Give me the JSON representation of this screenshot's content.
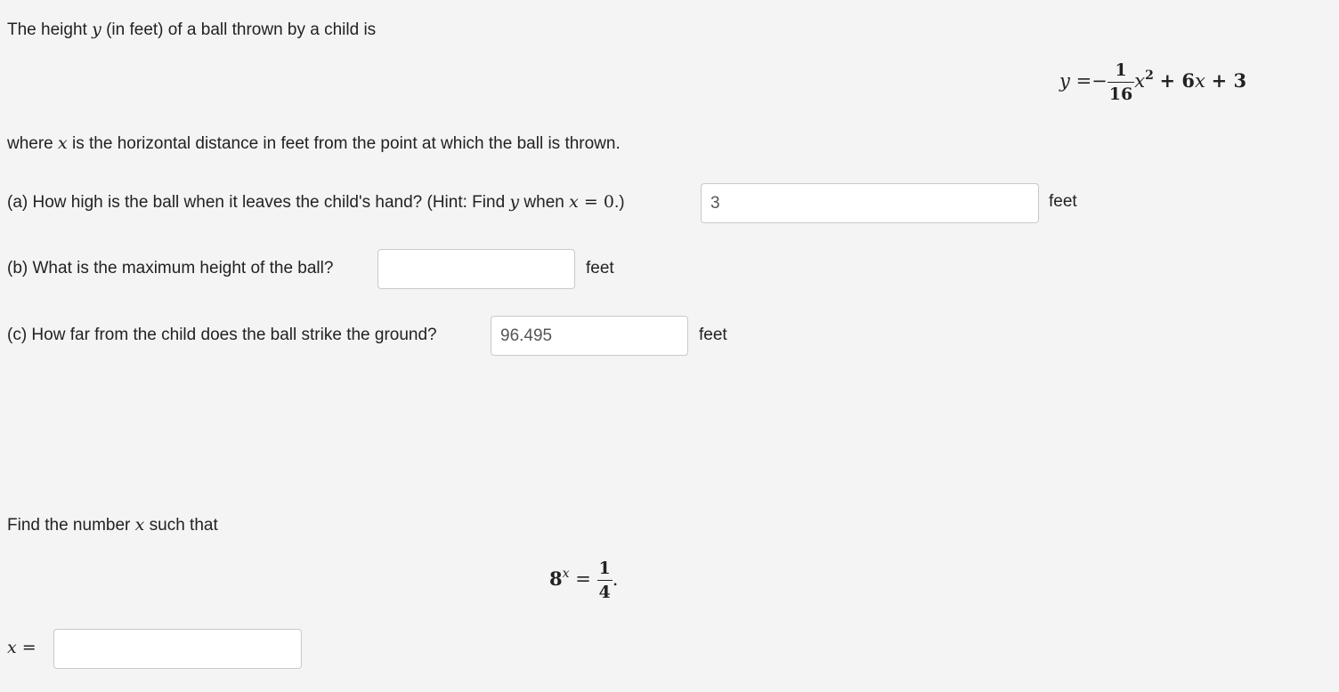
{
  "problem1": {
    "intro_a": "The height ",
    "intro_var": "y",
    "intro_b": " (in feet) of a ball thrown by a child is",
    "equation": {
      "lhs": "y",
      "eq": "=",
      "minus": "−",
      "frac_num": "1",
      "frac_den": "16",
      "x": "x",
      "exp": "2",
      "rest": "+ 6",
      "x2": "x",
      "tail": "+ 3"
    },
    "where_a": "where ",
    "where_var": "x",
    "where_b": " is the horizontal distance in feet from the point at which the ball is thrown.",
    "part_a": {
      "text_a": "(a) How high is the ball when it leaves the child's hand? (Hint: Find ",
      "var_y": "y",
      "text_b": " when ",
      "var_x": "x",
      "text_c": " = ",
      "zero": "0",
      "text_d": ".)",
      "value": "3",
      "unit": "feet"
    },
    "part_b": {
      "text": "(b) What is the maximum height of the ball?",
      "value": "",
      "unit": "feet"
    },
    "part_c": {
      "text": "(c) How far from the child does the ball strike the ground?",
      "value": "96.495",
      "unit": "feet"
    }
  },
  "problem2": {
    "intro_a": "Find the number ",
    "intro_var": "x",
    "intro_b": " such that",
    "equation": {
      "base": "8",
      "exp": "x",
      "eq": "=",
      "frac_num": "1",
      "frac_den": "4",
      "period": "."
    },
    "answer_label_var": "x",
    "answer_label_eq": " =",
    "value": ""
  }
}
